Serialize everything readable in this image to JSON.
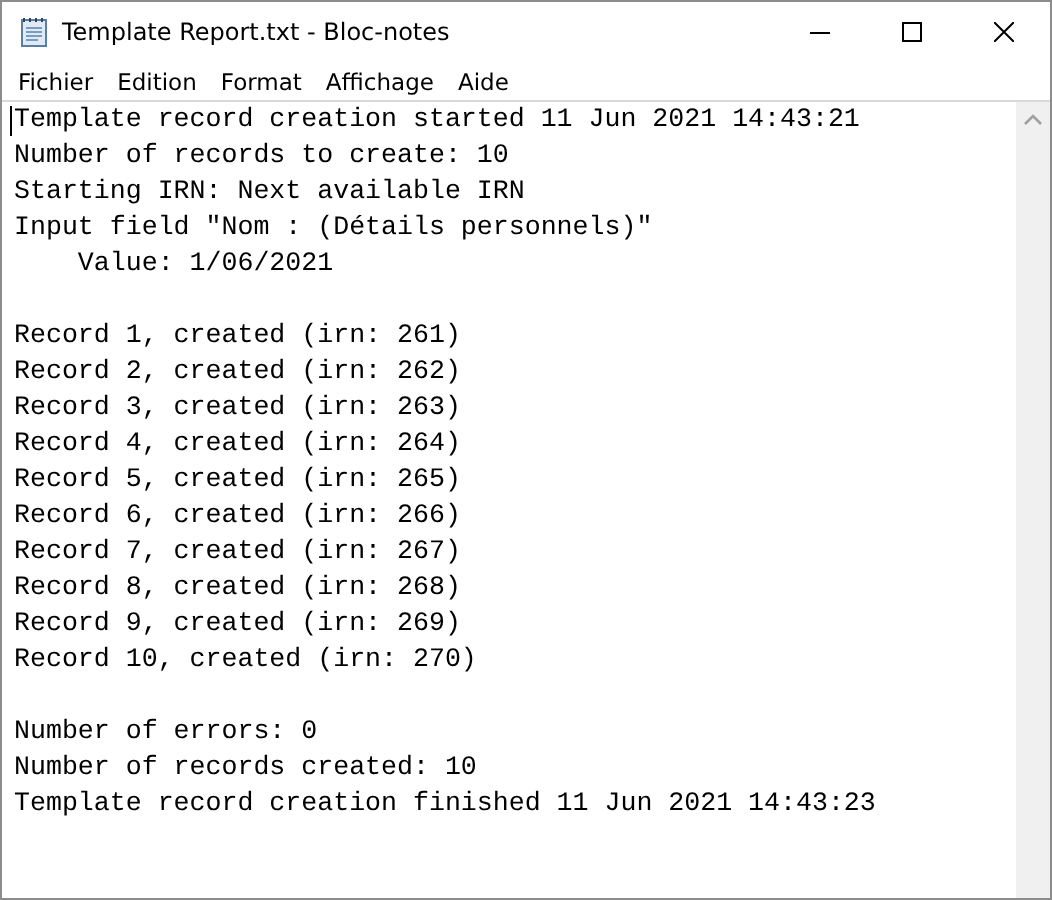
{
  "window": {
    "title": "Template Report.txt - Bloc-notes"
  },
  "menu": [
    "Fichier",
    "Edition",
    "Format",
    "Affichage",
    "Aide"
  ],
  "document": {
    "paragraphs": [
      [
        "Template record creation started 11 Jun 2021 14:43:21",
        "Number of records to create: 10",
        "Starting IRN: Next available IRN",
        "Input field \"Nom : (Détails personnels)\"",
        "    Value: 1/06/2021"
      ],
      [
        "Record 1, created (irn: 261)",
        "Record 2, created (irn: 262)",
        "Record 3, created (irn: 263)",
        "Record 4, created (irn: 264)",
        "Record 5, created (irn: 265)",
        "Record 6, created (irn: 266)",
        "Record 7, created (irn: 267)",
        "Record 8, created (irn: 268)",
        "Record 9, created (irn: 269)",
        "Record 10, created (irn: 270)"
      ],
      [
        "Number of errors: 0",
        "Number of records created: 10",
        "Template record creation finished 11 Jun 2021 14:43:23"
      ]
    ]
  }
}
